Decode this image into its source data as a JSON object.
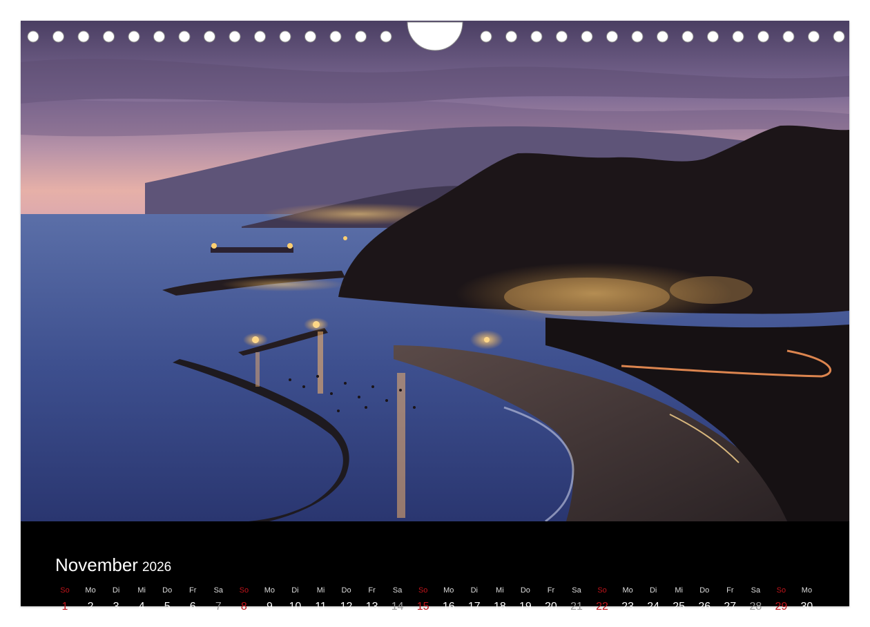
{
  "calendar": {
    "month": "November",
    "year": "2026",
    "days": [
      {
        "wd": "So",
        "n": "1",
        "kind": "sun"
      },
      {
        "wd": "Mo",
        "n": "2",
        "kind": ""
      },
      {
        "wd": "Di",
        "n": "3",
        "kind": ""
      },
      {
        "wd": "Mi",
        "n": "4",
        "kind": ""
      },
      {
        "wd": "Do",
        "n": "5",
        "kind": ""
      },
      {
        "wd": "Fr",
        "n": "6",
        "kind": ""
      },
      {
        "wd": "Sa",
        "n": "7",
        "kind": "sat"
      },
      {
        "wd": "So",
        "n": "8",
        "kind": "sun"
      },
      {
        "wd": "Mo",
        "n": "9",
        "kind": ""
      },
      {
        "wd": "Di",
        "n": "10",
        "kind": ""
      },
      {
        "wd": "Mi",
        "n": "11",
        "kind": ""
      },
      {
        "wd": "Do",
        "n": "12",
        "kind": ""
      },
      {
        "wd": "Fr",
        "n": "13",
        "kind": ""
      },
      {
        "wd": "Sa",
        "n": "14",
        "kind": "sat"
      },
      {
        "wd": "So",
        "n": "15",
        "kind": "sun"
      },
      {
        "wd": "Mo",
        "n": "16",
        "kind": ""
      },
      {
        "wd": "Di",
        "n": "17",
        "kind": ""
      },
      {
        "wd": "Mi",
        "n": "18",
        "kind": ""
      },
      {
        "wd": "Do",
        "n": "19",
        "kind": ""
      },
      {
        "wd": "Fr",
        "n": "20",
        "kind": ""
      },
      {
        "wd": "Sa",
        "n": "21",
        "kind": "sat"
      },
      {
        "wd": "So",
        "n": "22",
        "kind": "sun"
      },
      {
        "wd": "Mo",
        "n": "23",
        "kind": ""
      },
      {
        "wd": "Di",
        "n": "24",
        "kind": ""
      },
      {
        "wd": "Mi",
        "n": "25",
        "kind": ""
      },
      {
        "wd": "Do",
        "n": "26",
        "kind": ""
      },
      {
        "wd": "Fr",
        "n": "27",
        "kind": ""
      },
      {
        "wd": "Sa",
        "n": "28",
        "kind": "sat"
      },
      {
        "wd": "So",
        "n": "29",
        "kind": "sun"
      },
      {
        "wd": "Mo",
        "n": "30",
        "kind": ""
      }
    ]
  },
  "colors": {
    "sunday": "#c0141b",
    "saturday": "#9a9a9a",
    "weekday": "#ffffff",
    "calendar_bg": "#000000"
  }
}
